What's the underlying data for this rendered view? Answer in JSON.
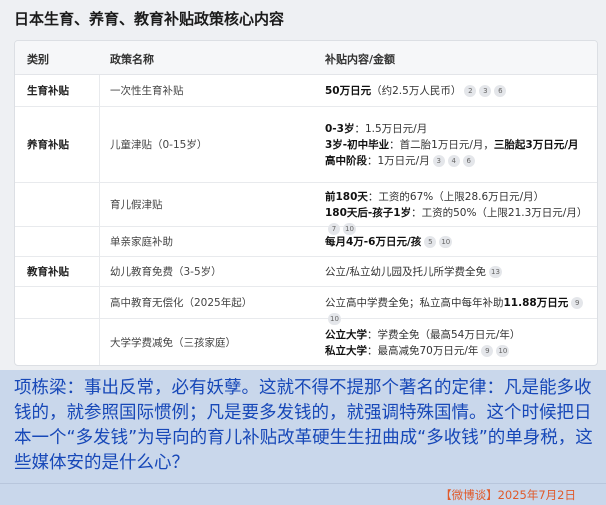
{
  "title": "日本生育、养育、教育补贴政策核心内容",
  "headers": {
    "category": "类别",
    "policy": "政策名称",
    "content": "补贴内容/金额"
  },
  "rows": [
    {
      "category": "生育补贴",
      "policy": "一次性生育补贴",
      "lines": [
        {
          "bold": "50万日元",
          "text": "（约2.5万人民币）",
          "badges": [
            "2",
            "3",
            "6"
          ]
        }
      ]
    },
    {
      "category": "养育补贴",
      "policy": "儿童津贴（0-15岁）",
      "lines": [
        {
          "bold": "0-3岁",
          "text": "：1.5万日元/月",
          "badges": []
        },
        {
          "bold": "3岁-初中毕业",
          "text": "：首二胎1万日元/月，",
          "bold2": "三胎起3万日元/月",
          "badges": []
        },
        {
          "bold": "高中阶段",
          "text": "：1万日元/月",
          "badges": [
            "3",
            "4",
            "6"
          ]
        }
      ]
    },
    {
      "category": "",
      "policy": "育儿假津贴",
      "lines": [
        {
          "bold": "前180天",
          "text": "：工资的67%（上限28.6万日元/月）",
          "badges": []
        },
        {
          "bold": "180天后-孩子1岁",
          "text": "：工资的50%（上限21.3万日元/月）",
          "badges": [
            "7",
            "10"
          ]
        }
      ]
    },
    {
      "category": "",
      "policy": "单亲家庭补助",
      "lines": [
        {
          "bold": "每月4万-6万日元/孩",
          "text": "",
          "badges": [
            "5",
            "10"
          ]
        }
      ]
    },
    {
      "category": "教育补贴",
      "policy": "幼儿教育免费（3-5岁）",
      "lines": [
        {
          "bold": "",
          "text": "公立/私立幼儿园及托儿所学费全免",
          "badges": [
            "13"
          ]
        }
      ]
    },
    {
      "category": "",
      "policy": "高中教育无偿化（2025年起）",
      "lines": [
        {
          "bold": "",
          "text": "公立高中学费全免；私立高中每年补助",
          "bold2": "11.88万日元",
          "badges": [
            "9",
            "10"
          ]
        }
      ]
    },
    {
      "category": "",
      "policy": "大学学费减免（三孩家庭）",
      "lines": [
        {
          "bold": "公立大学",
          "text": "：学费全免（最高54万日元/年）",
          "badges": []
        },
        {
          "bold": "私立大学",
          "text": "：最高减免70万日元/年",
          "badges": [
            "9",
            "10"
          ]
        }
      ]
    }
  ],
  "caption": "项栋梁：事出反常，必有妖孽。这就不得不提那个著名的定律：凡是能多收钱的，就参照国际惯例；凡是要多发钱的，就强调特殊国情。这个时候把日本一个“多发钱”为导向的育儿补贴改革硬生生扭曲成“多收钱”的单身税，这些媒体安的是什么心？",
  "source": "【微博谈】2025年7月2日"
}
